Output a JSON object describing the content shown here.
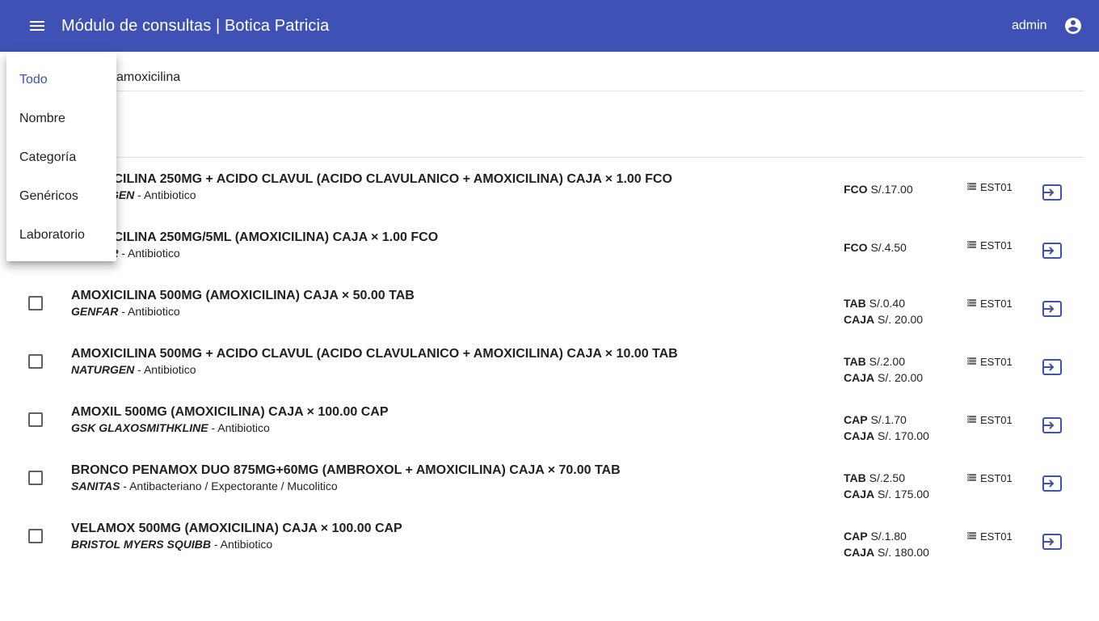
{
  "app": {
    "title": "Módulo de consultas | Botica Patricia",
    "user": "admin",
    "colors": {
      "primary": "#3f51b5",
      "text": "#212121"
    }
  },
  "search": {
    "value": "amoxicilina"
  },
  "filter_menu": {
    "items": [
      "Todo",
      "Nombre",
      "Categoría",
      "Genéricos",
      "Laboratorio"
    ],
    "selected": "Todo"
  },
  "products": [
    {
      "name": "AMOXICILINA 250MG + ACIDO CLAVUL (ACIDO CLAVULANICO + AMOXICILINA) CAJA × 1.00 FCO",
      "lab": "NATURGEN",
      "category": " - Antibiotico",
      "prices": [
        {
          "unit": "FCO",
          "price": " S/.17.00"
        }
      ],
      "store": "EST01"
    },
    {
      "name": "AMOXICILINA 250MG/5ML (AMOXICILINA) CAJA × 1.00 FCO",
      "lab": "GENFAR",
      "category": " - Antibiotico",
      "prices": [
        {
          "unit": "FCO",
          "price": " S/.4.50"
        }
      ],
      "store": "EST01"
    },
    {
      "name": "AMOXICILINA 500MG (AMOXICILINA) CAJA × 50.00 TAB",
      "lab": "GENFAR",
      "category": " - Antibiotico",
      "prices": [
        {
          "unit": "TAB",
          "price": " S/.0.40"
        },
        {
          "unit": "CAJA",
          "price": " S/. 20.00"
        }
      ],
      "store": "EST01"
    },
    {
      "name": "AMOXICILINA 500MG + ACIDO CLAVUL (ACIDO CLAVULANICO + AMOXICILINA) CAJA × 10.00 TAB",
      "lab": "NATURGEN",
      "category": " - Antibiotico",
      "prices": [
        {
          "unit": "TAB",
          "price": " S/.2.00"
        },
        {
          "unit": "CAJA",
          "price": " S/. 20.00"
        }
      ],
      "store": "EST01"
    },
    {
      "name": "AMOXIL 500MG (AMOXICILINA) CAJA × 100.00 CAP",
      "lab": "GSK GLAXOSMITHKLINE",
      "category": " - Antibiotico",
      "prices": [
        {
          "unit": "CAP",
          "price": " S/.1.70"
        },
        {
          "unit": "CAJA",
          "price": " S/. 170.00"
        }
      ],
      "store": "EST01"
    },
    {
      "name": "BRONCO PENAMOX DUO 875MG+60MG (AMBROXOL + AMOXICILINA) CAJA × 70.00 TAB",
      "lab": "SANITAS",
      "category": " - Antibacteriano / Expectorante / Mucolitico",
      "prices": [
        {
          "unit": "TAB",
          "price": " S/.2.50"
        },
        {
          "unit": "CAJA",
          "price": " S/. 175.00"
        }
      ],
      "store": "EST01"
    },
    {
      "name": "VELAMOX 500MG (AMOXICILINA) CAJA × 100.00 CAP",
      "lab": "BRISTOL MYERS SQUIBB",
      "category": " - Antibiotico",
      "prices": [
        {
          "unit": "CAP",
          "price": " S/.1.80"
        },
        {
          "unit": "CAJA",
          "price": " S/. 180.00"
        }
      ],
      "store": "EST01"
    }
  ]
}
